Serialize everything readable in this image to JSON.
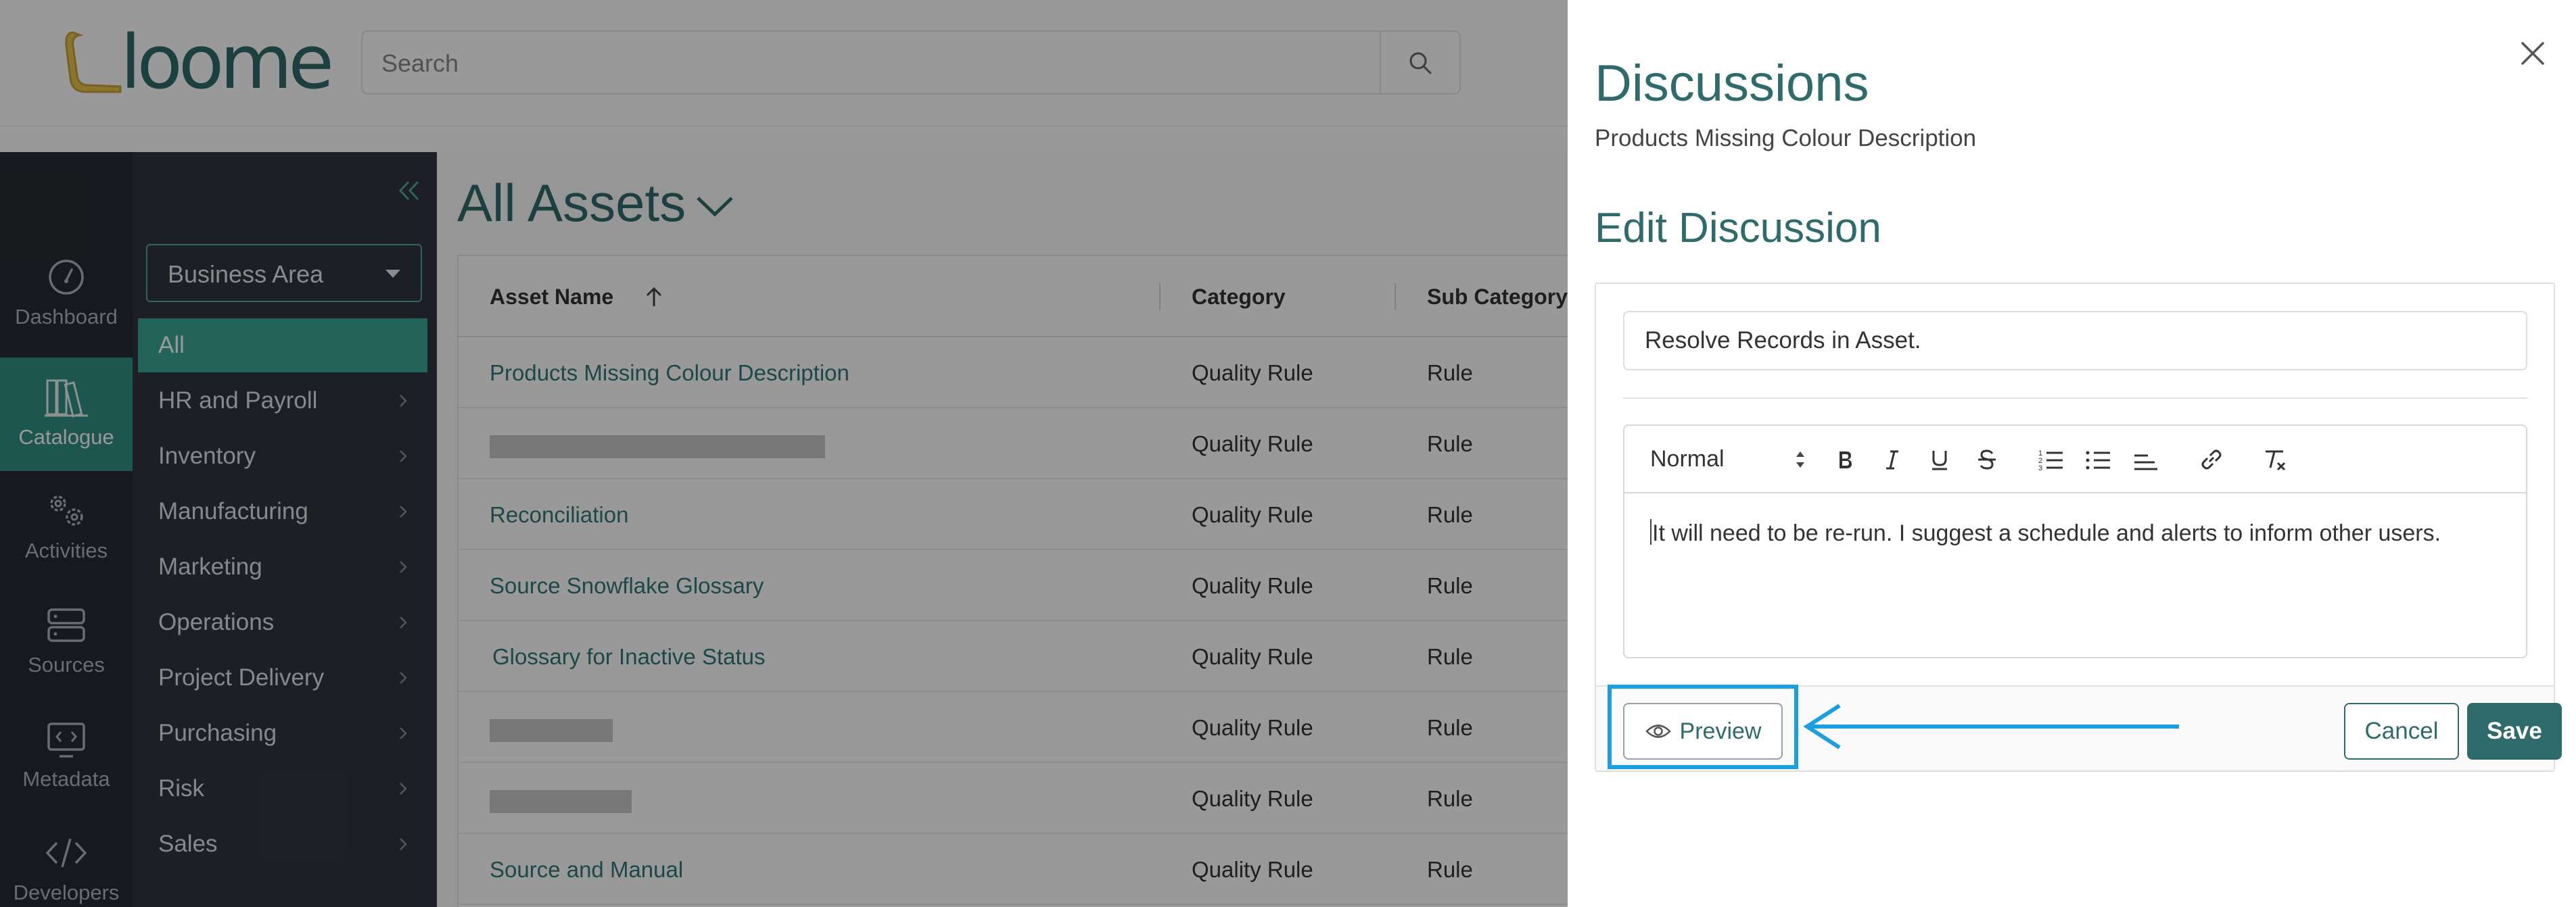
{
  "app": {
    "logo_text": "loome",
    "search": {
      "placeholder": "Search",
      "value": ""
    }
  },
  "rail": {
    "items": [
      {
        "label": "Dashboard",
        "icon": "gauge-icon",
        "active": false
      },
      {
        "label": "Catalogue",
        "icon": "books-icon",
        "active": true
      },
      {
        "label": "Activities",
        "icon": "gears-icon",
        "active": false
      },
      {
        "label": "Sources",
        "icon": "server-icon",
        "active": false
      },
      {
        "label": "Metadata",
        "icon": "code-window-icon",
        "active": false
      },
      {
        "label": "Developers",
        "icon": "code-brackets-icon",
        "active": false
      }
    ]
  },
  "catalogue_nav": {
    "business_area_label": "Business Area",
    "items": [
      {
        "label": "All",
        "active": true
      },
      {
        "label": "HR and Payroll"
      },
      {
        "label": "Inventory"
      },
      {
        "label": "Manufacturing"
      },
      {
        "label": "Marketing"
      },
      {
        "label": "Operations"
      },
      {
        "label": "Project Delivery"
      },
      {
        "label": "Purchasing"
      },
      {
        "label": "Risk"
      },
      {
        "label": "Sales"
      }
    ]
  },
  "main": {
    "title": "All Assets",
    "columns": {
      "asset_name": "Asset Name",
      "category": "Category",
      "sub_category": "Sub Category"
    },
    "rows": [
      {
        "name": "Products Missing Colour Description",
        "category": "Quality Rule",
        "sub_category": "Rule"
      },
      {
        "name": "",
        "category": "Quality Rule",
        "sub_category": "Rule"
      },
      {
        "name": "Reconciliation",
        "category": "Quality Rule",
        "sub_category": "Rule"
      },
      {
        "name": "Source Snowflake Glossary",
        "category": "Quality Rule",
        "sub_category": "Rule"
      },
      {
        "name": "Glossary for Inactive Status",
        "category": "Quality Rule",
        "sub_category": "Rule"
      },
      {
        "name": "",
        "category": "Quality Rule",
        "sub_category": "Rule"
      },
      {
        "name": "",
        "category": "Quality Rule",
        "sub_category": "Rule"
      },
      {
        "name": "Source and Manual",
        "category": "Quality Rule",
        "sub_category": "Rule"
      }
    ]
  },
  "panel": {
    "title": "Discussions",
    "subtitle": "Products Missing Colour Description",
    "edit_title": "Edit Discussion",
    "discussion_title_value": "Resolve Records in Asset.",
    "format_value": "Normal",
    "body_text": "It will need to be re-run. I suggest a schedule and alerts to inform other users.",
    "toolbar": {
      "bold": "B",
      "italic": "I",
      "underline": "U",
      "strike": "S"
    },
    "preview_label": "Preview",
    "cancel_label": "Cancel",
    "save_label": "Save"
  },
  "colors": {
    "brand_teal": "#2f6b6b",
    "active_green": "#3aa597",
    "highlight_blue": "#1a9fe0"
  }
}
